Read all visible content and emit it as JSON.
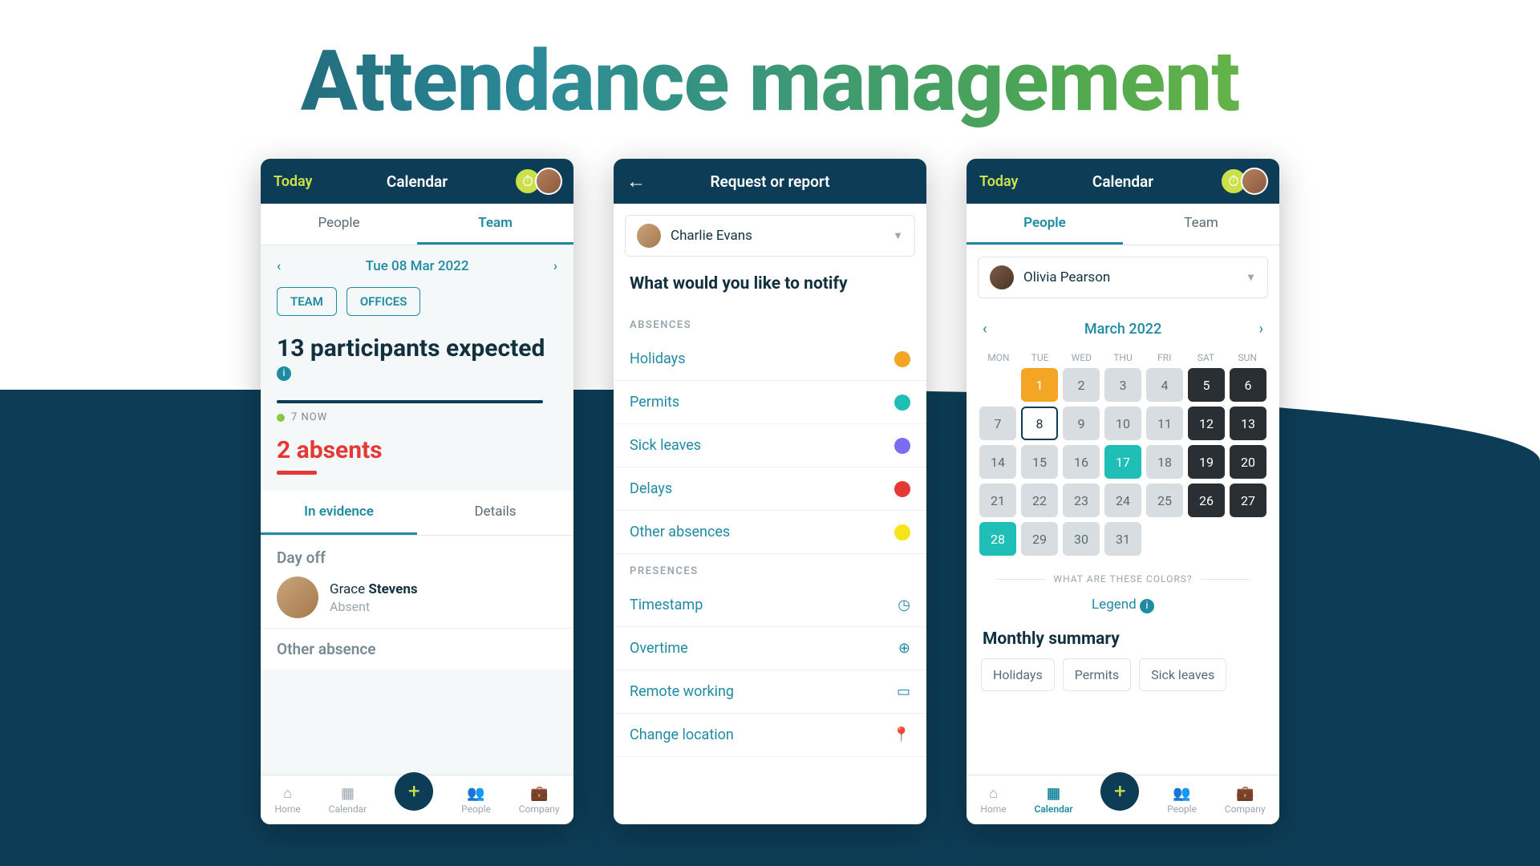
{
  "page_title": "Attendance management",
  "colors": {
    "holidays": "#f4a524",
    "permits": "#1fbfb8",
    "sick": "#7b6cf0",
    "delays": "#e53935",
    "other": "#f6e41a"
  },
  "phone1": {
    "today": "Today",
    "calendar": "Calendar",
    "tab_people": "People",
    "tab_team": "Team",
    "date": "Tue 08 Mar 2022",
    "pill_team": "TEAM",
    "pill_offices": "OFFICES",
    "expected": "13 participants expected",
    "now_label": "7 NOW",
    "absents": "2 absents",
    "subtab_evidence": "In evidence",
    "subtab_details": "Details",
    "dayoff_title": "Day off",
    "person_first": "Grace",
    "person_last": "Stevens",
    "person_status": "Absent",
    "other_absence": "Other absence",
    "nav": {
      "home": "Home",
      "calendar": "Calendar",
      "people": "People",
      "company": "Company"
    }
  },
  "phone2": {
    "title": "Request or report",
    "user": "Charlie Evans",
    "notify_title": "What would you like to notify",
    "absences_header": "ABSENCES",
    "items_absences": {
      "holidays": "Holidays",
      "permits": "Permits",
      "sick": "Sick leaves",
      "delays": "Delays",
      "other": "Other absences"
    },
    "presences_header": "PRESENCES",
    "items_presences": {
      "timestamp": "Timestamp",
      "overtime": "Overtime",
      "remote": "Remote working",
      "location": "Change location"
    }
  },
  "phone3": {
    "today": "Today",
    "calendar": "Calendar",
    "tab_people": "People",
    "tab_team": "Team",
    "user": "Olivia Pearson",
    "month": "March 2022",
    "dow": [
      "MON",
      "TUE",
      "WED",
      "THU",
      "FRI",
      "SAT",
      "SUN"
    ],
    "colors_header": "WHAT ARE THESE COLORS?",
    "legend": "Legend",
    "monthly": "Monthly summary",
    "chips": {
      "holidays": "Holidays",
      "permits": "Permits",
      "sick": "Sick leaves"
    },
    "nav": {
      "home": "Home",
      "calendar": "Calendar",
      "people": "People",
      "company": "Company"
    },
    "calendar_days": [
      {
        "d": "1",
        "s": "orange"
      },
      {
        "d": "2",
        "s": "gray"
      },
      {
        "d": "3",
        "s": "gray"
      },
      {
        "d": "4",
        "s": "gray"
      },
      {
        "d": "5",
        "s": "dark"
      },
      {
        "d": "6",
        "s": "dark"
      },
      {
        "d": "7",
        "s": "gray"
      },
      {
        "d": "8",
        "s": "today"
      },
      {
        "d": "9",
        "s": "gray"
      },
      {
        "d": "10",
        "s": "gray"
      },
      {
        "d": "11",
        "s": "gray"
      },
      {
        "d": "12",
        "s": "dark"
      },
      {
        "d": "13",
        "s": "dark"
      },
      {
        "d": "14",
        "s": "gray"
      },
      {
        "d": "15",
        "s": "gray"
      },
      {
        "d": "16",
        "s": "gray"
      },
      {
        "d": "17",
        "s": "teal"
      },
      {
        "d": "18",
        "s": "gray"
      },
      {
        "d": "19",
        "s": "dark"
      },
      {
        "d": "20",
        "s": "dark"
      },
      {
        "d": "21",
        "s": "gray"
      },
      {
        "d": "22",
        "s": "gray"
      },
      {
        "d": "23",
        "s": "gray"
      },
      {
        "d": "24",
        "s": "gray"
      },
      {
        "d": "25",
        "s": "gray"
      },
      {
        "d": "26",
        "s": "dark"
      },
      {
        "d": "27",
        "s": "dark"
      },
      {
        "d": "28",
        "s": "teal"
      },
      {
        "d": "29",
        "s": "gray"
      },
      {
        "d": "30",
        "s": "gray"
      },
      {
        "d": "31",
        "s": "gray"
      }
    ]
  }
}
